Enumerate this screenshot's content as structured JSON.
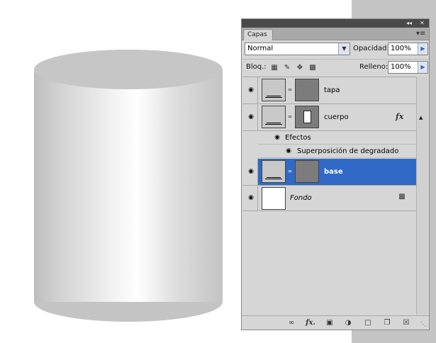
{
  "panel": {
    "tab_label": "Capas",
    "collapse_glyph": "◂◂",
    "close_glyph": "✕",
    "menu_glyph": "▾≡",
    "blend_mode": "Normal",
    "opacity_label": "Opacidad:",
    "opacity_value": "100%",
    "lock_label": "Bloq.:",
    "fill_label": "Relleno:",
    "fill_value": "100%",
    "lock_icons": [
      "lock-transparency-icon",
      "lock-paint-icon",
      "lock-move-icon",
      "lock-all-icon"
    ]
  },
  "layers": [
    {
      "name": "tapa",
      "visible": true,
      "has_mask": true,
      "selected": false
    },
    {
      "name": "cuerpo",
      "visible": true,
      "has_mask": true,
      "selected": false,
      "fx_label": "fx",
      "effects_label": "Efectos",
      "effects": [
        {
          "name": "Superposición de degradado"
        }
      ]
    },
    {
      "name": "base",
      "visible": true,
      "has_mask": true,
      "selected": true
    },
    {
      "name": "Fondo",
      "visible": true,
      "has_mask": false,
      "selected": false,
      "locked": true
    }
  ],
  "bottom_bar": {
    "icons": [
      "link-layers-icon",
      "fx-icon",
      "add-mask-icon",
      "adjustment-layer-icon",
      "new-group-icon",
      "new-layer-icon",
      "trash-icon"
    ],
    "fx_label": "fx."
  },
  "colors": {
    "selection": "#3169c6",
    "panel_bg": "#d6d6d6",
    "topbar": "#4a4a4a"
  }
}
